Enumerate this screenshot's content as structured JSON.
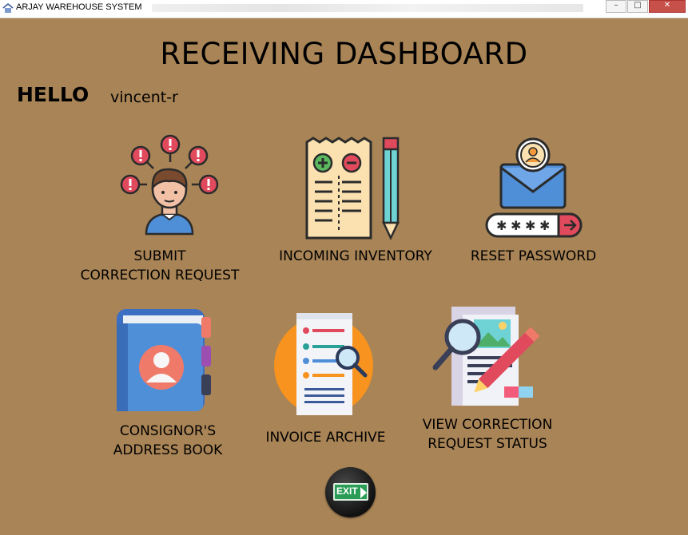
{
  "window": {
    "title": "ARJAY WAREHOUSE SYSTEM",
    "minimize": "–",
    "maximize": "□",
    "close": "✕"
  },
  "header": {
    "title": "RECEIVING DASHBOARD",
    "greeting": "HELLO",
    "username": "vincent-r"
  },
  "tiles": [
    {
      "line1": "SUBMIT",
      "line2": "CORRECTION REQUEST",
      "icon": "correction-request-icon"
    },
    {
      "line1": "INCOMING INVENTORY",
      "icon": "incoming-inventory-icon"
    },
    {
      "line1": "RESET PASSWORD",
      "icon": "reset-password-icon"
    },
    {
      "line1": "CONSIGNOR'S",
      "line2": "ADDRESS BOOK",
      "icon": "address-book-icon"
    },
    {
      "line1": "INVOICE ARCHIVE",
      "icon": "invoice-archive-icon"
    },
    {
      "line1": "VIEW CORRECTION",
      "line2": "REQUEST STATUS",
      "icon": "request-status-icon"
    }
  ],
  "exit": {
    "label": "EXIT"
  },
  "colors": {
    "background": "#a98456",
    "accent_red": "#e04a5c",
    "accent_teal": "#6fd3d6",
    "exit_green": "#2a9c55"
  }
}
